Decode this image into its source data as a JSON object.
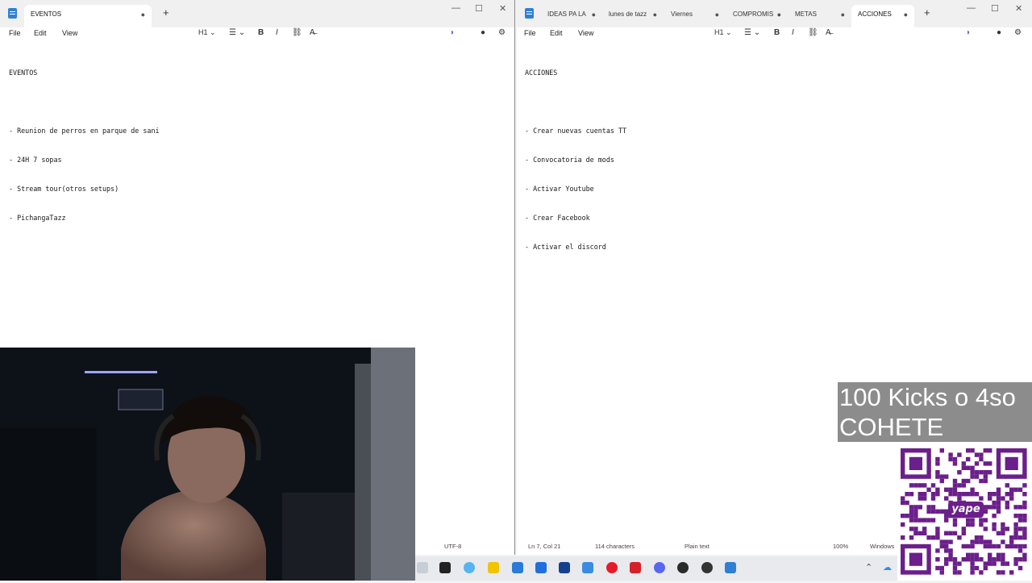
{
  "left_window": {
    "tabs": [
      {
        "label": "EVENTOS",
        "active": true
      }
    ],
    "menu": [
      "File",
      "Edit",
      "View"
    ],
    "heading_button": "H1",
    "bold_label": "B",
    "italic_label": "I",
    "document_lines": [
      "EVENTOS",
      "",
      "- Reunion de perros en parque de sani",
      "- 24H 7 sopas",
      "- Stream tour(otros setups)",
      "- PichangaTazz"
    ],
    "status": {
      "encoding": "UTF-8"
    }
  },
  "right_window": {
    "tabs": [
      {
        "label": "IDEAS PA LA",
        "active": false
      },
      {
        "label": "lunes de tazz",
        "active": false
      },
      {
        "label": "Viernes",
        "active": false
      },
      {
        "label": "COMPROMIS",
        "active": false
      },
      {
        "label": "METAS",
        "active": false
      },
      {
        "label": "ACCIONES",
        "active": true
      }
    ],
    "menu": [
      "File",
      "Edit",
      "View"
    ],
    "heading_button": "H1",
    "bold_label": "B",
    "italic_label": "I",
    "document_lines": [
      "ACCIONES",
      "",
      "- Crear nuevas cuentas TT",
      "- Convocatoria de mods",
      "- Activar Youtube",
      "- Crear Facebook",
      "- Activar el discord"
    ],
    "status": {
      "position": "Ln 7, Col 21",
      "characters": "114 characters",
      "format": "Plain text",
      "zoom": "100%",
      "line_ending": "Windows"
    }
  },
  "overlay": {
    "goal_text_line1": "100 Kicks o 4so",
    "goal_text_line2": "COHETE",
    "qr_brand": "yape"
  },
  "colors": {
    "accent": "#2f7fd6",
    "overlay_bg": "#8c8c8c",
    "qr_purple": "#6b1f8a"
  }
}
